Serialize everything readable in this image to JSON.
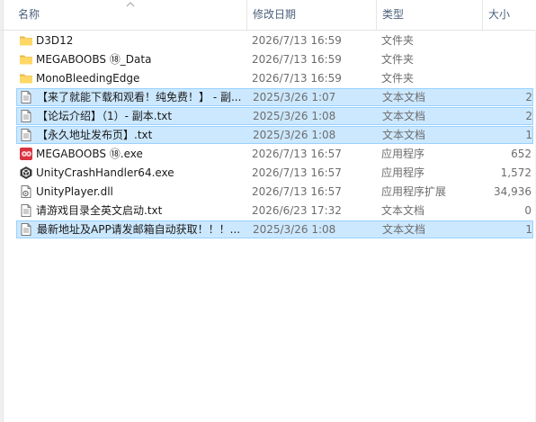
{
  "columns": {
    "name": "名称",
    "date": "修改日期",
    "type": "类型",
    "size": "大小"
  },
  "files": [
    {
      "name": "D3D12",
      "date": "2026/7/13 16:59",
      "type": "文件夹",
      "size": "",
      "icon": "folder-icon",
      "selected": false
    },
    {
      "name": "MEGABOOBS ⑱_Data",
      "date": "2026/7/13 16:59",
      "type": "文件夹",
      "size": "",
      "icon": "folder-icon",
      "selected": false
    },
    {
      "name": "MonoBleedingEdge",
      "date": "2026/7/13 16:59",
      "type": "文件夹",
      "size": "",
      "icon": "folder-icon",
      "selected": false
    },
    {
      "name": "【来了就能下载和观看！纯免费！】 - 副...",
      "date": "2025/3/26 1:07",
      "type": "文本文档",
      "size": "2",
      "icon": "text-file-icon",
      "selected": true
    },
    {
      "name": "【论坛介绍】（1）- 副本.txt",
      "date": "2025/3/26 1:08",
      "type": "文本文档",
      "size": "2",
      "icon": "text-file-icon",
      "selected": true
    },
    {
      "name": "【永久地址发布页】.txt",
      "date": "2025/3/26 1:08",
      "type": "文本文档",
      "size": "1",
      "icon": "text-file-icon",
      "selected": true
    },
    {
      "name": "MEGABOOBS ⑱.exe",
      "date": "2026/7/13 16:57",
      "type": "应用程序",
      "size": "652",
      "icon": "game-exe-icon",
      "selected": false
    },
    {
      "name": "UnityCrashHandler64.exe",
      "date": "2026/7/13 16:57",
      "type": "应用程序",
      "size": "1,572",
      "icon": "unity-icon",
      "selected": false
    },
    {
      "name": "UnityPlayer.dll",
      "date": "2026/7/13 16:57",
      "type": "应用程序扩展",
      "size": "34,936",
      "icon": "dll-file-icon",
      "selected": false
    },
    {
      "name": "请游戏目录全英文启动.txt",
      "date": "2026/6/23 17:32",
      "type": "文本文档",
      "size": "0",
      "icon": "text-file-icon",
      "selected": false
    },
    {
      "name": "最新地址及APP请发邮箱自动获取！！！...",
      "date": "2025/3/26 1:08",
      "type": "文本文档",
      "size": "1",
      "icon": "text-file-icon",
      "selected": true
    }
  ],
  "colors": {
    "selection_fill": "#cce8ff",
    "selection_border": "#99d1ff",
    "header_text": "#4c607a",
    "folder": "#ffd766"
  }
}
